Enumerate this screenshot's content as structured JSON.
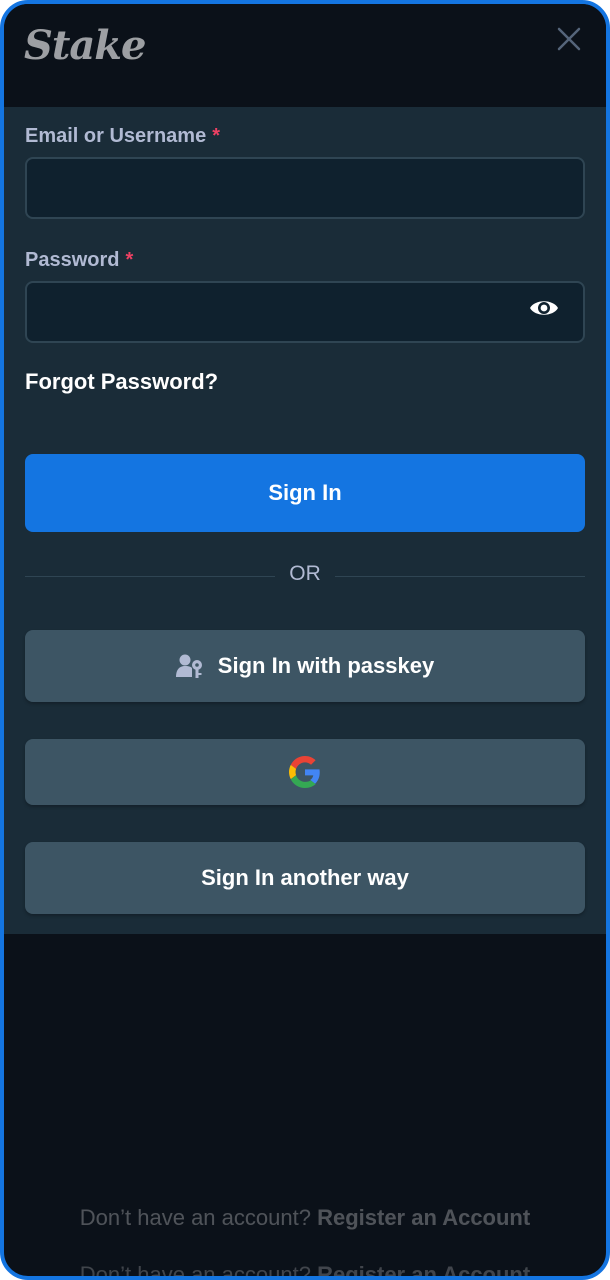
{
  "brand": {
    "logo_text": "Stake"
  },
  "form": {
    "email": {
      "label": "Email or Username",
      "required_mark": "*",
      "value": "",
      "placeholder": ""
    },
    "password": {
      "label": "Password",
      "required_mark": "*",
      "value": "",
      "placeholder": ""
    },
    "forgot_password": "Forgot Password?",
    "sign_in": "Sign In",
    "or": "OR",
    "passkey": "Sign In with passkey",
    "google_icon": "google-icon",
    "another_way": "Sign In another way"
  },
  "footer": {
    "prompt": "Don’t have an account?",
    "register": "Register an Account"
  },
  "colors": {
    "accent": "#1475e1",
    "panel": "#1a2c38",
    "background": "#0b1119",
    "input": "#0f212e",
    "secondary_button": "#3d5564",
    "required": "#ed4163"
  }
}
